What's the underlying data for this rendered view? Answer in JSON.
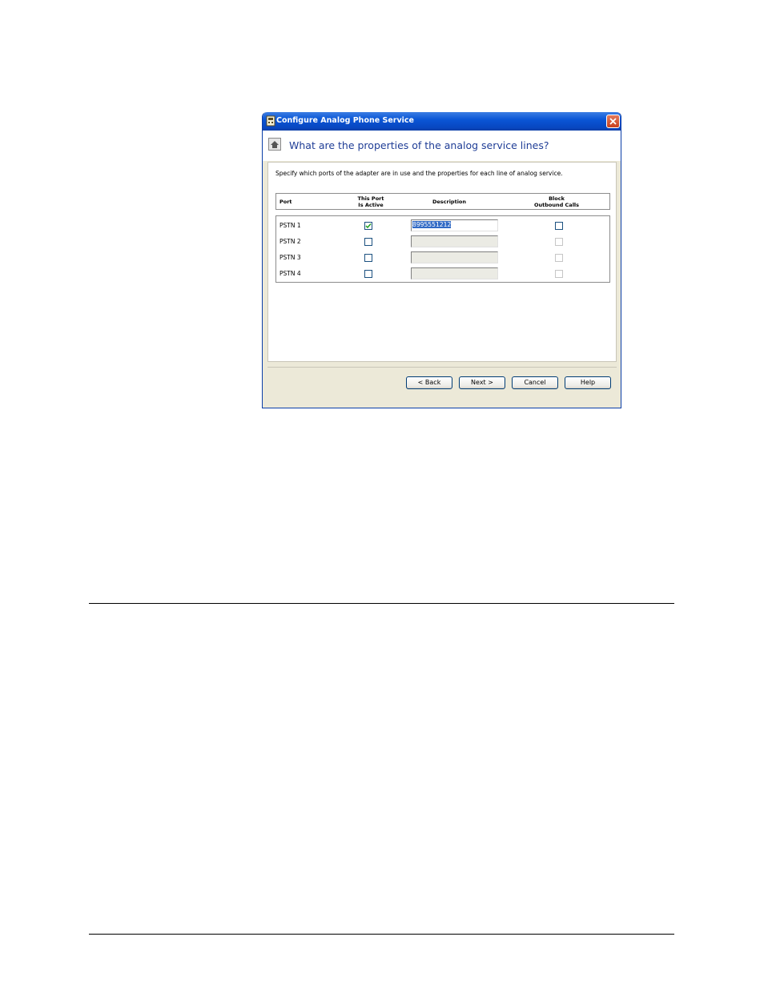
{
  "window": {
    "title": "Configure Analog Phone Service",
    "heading": "What are the properties of the analog service lines?",
    "instructions": "Specify which ports of the adapter are in use and the properties for each line of analog service."
  },
  "columns": {
    "port": "Port",
    "active_line1": "This Port",
    "active_line2": "Is Active",
    "description": "Description",
    "block_line1": "Block",
    "block_line2": "Outbound Calls"
  },
  "rows": [
    {
      "port": "PSTN 1",
      "active": true,
      "description": "8995551212",
      "block": false,
      "enabled": true
    },
    {
      "port": "PSTN 2",
      "active": false,
      "description": "",
      "block": false,
      "enabled": false
    },
    {
      "port": "PSTN 3",
      "active": false,
      "description": "",
      "block": false,
      "enabled": false
    },
    {
      "port": "PSTN 4",
      "active": false,
      "description": "",
      "block": false,
      "enabled": false
    }
  ],
  "buttons": {
    "back": "< Back",
    "next": "Next >",
    "cancel": "Cancel",
    "help": "Help"
  },
  "colors": {
    "titlebar": "#0a56d6",
    "heading_text": "#1f3d96",
    "selection": "#316ac5",
    "check": "#21a121"
  }
}
